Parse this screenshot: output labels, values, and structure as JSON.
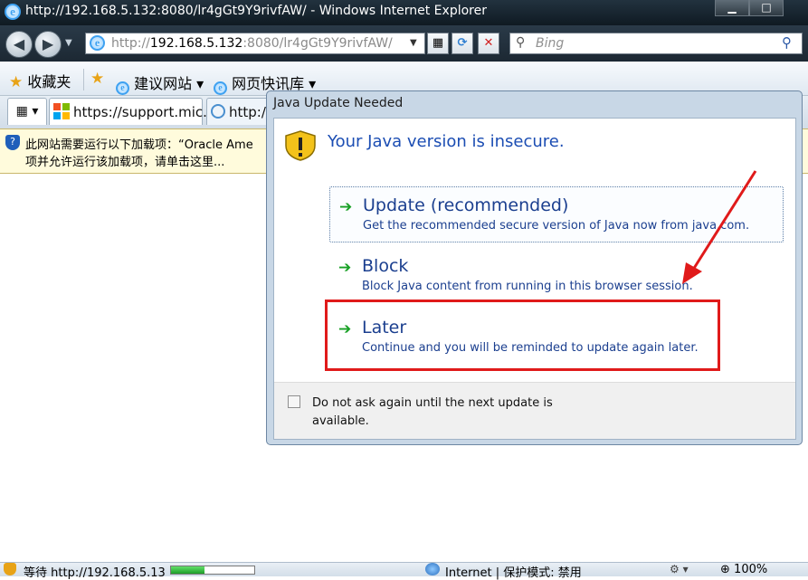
{
  "window": {
    "title": "http://192.168.5.132:8080/lr4gGt9Y9rivfAW/ - Windows Internet Explorer",
    "caption_buttons": [
      "▁",
      "□"
    ]
  },
  "navigation": {
    "address_gray_prefix": "http://",
    "address_host": "192.168.5.132",
    "address_rest": ":8080/lr4gGt9Y9rivfAW/",
    "search_placeholder": "Bing"
  },
  "favorites_bar": {
    "favorites_label": "收藏夹",
    "items": [
      "建议网站 ▾",
      "网页快讯库 ▾"
    ]
  },
  "tabs": [
    {
      "label": "https://support.mic..."
    },
    {
      "label": "http://"
    }
  ],
  "infobar": {
    "line1": "此网站需要运行以下加载项：“Oracle Ame",
    "line2": "项并允许运行该加载项，请单击这里..."
  },
  "dialog": {
    "title": "Java Update Needed",
    "heading": "Your Java version is insecure.",
    "options": [
      {
        "title": "Update (recommended)",
        "description": "Get the recommended secure version of Java now from java.com."
      },
      {
        "title": "Block",
        "description": "Block Java content from running in this browser session."
      },
      {
        "title": "Later",
        "description": "Continue and you will be reminded to update again later."
      }
    ],
    "checkbox_label": "Do not ask again until the next update is available.",
    "checkbox_checked": false
  },
  "annotation": {
    "highlight_color": "#e01a1a"
  },
  "statusbar": {
    "status_text": "等待 http://192.168.5.13",
    "progress": 0.4,
    "zone": "Internet | 保护模式: 禁用",
    "zoom": "100%"
  }
}
